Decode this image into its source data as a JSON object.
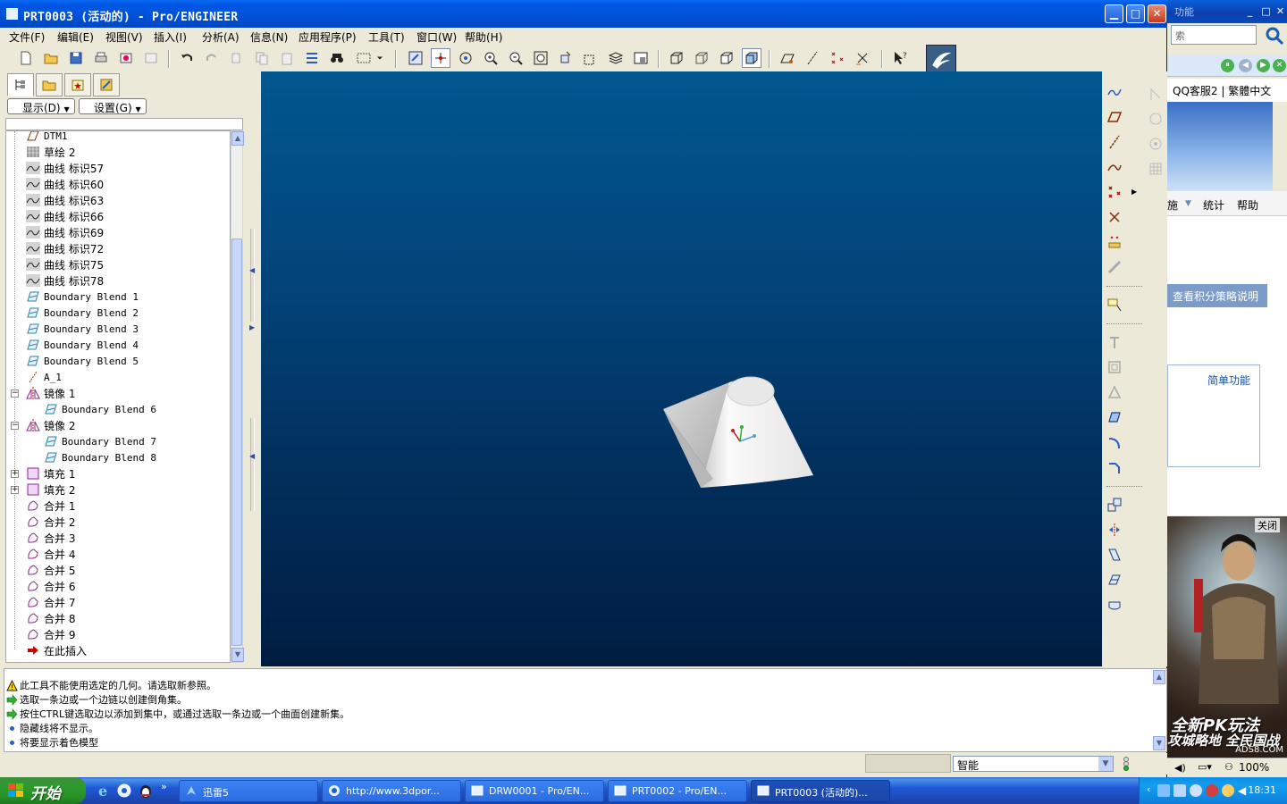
{
  "window": {
    "title": "PRT0003 (活动的) - Pro/ENGINEER",
    "controls": {
      "minimize": "_",
      "maximize": "□",
      "close": "X"
    }
  },
  "menubar": {
    "items": [
      "文件(F)",
      "编辑(E)",
      "视图(V)",
      "插入(I)",
      "分析(A)",
      "信息(N)",
      "应用程序(P)",
      "工具(T)",
      "窗口(W)",
      "帮助(H)"
    ]
  },
  "tree_panel": {
    "show_dropdown": "显示(D)",
    "settings_dropdown": "设置(G)",
    "items": [
      {
        "label": "DTM1",
        "icon": "datum-plane-icon",
        "level": 0,
        "expander": ""
      },
      {
        "label": "草绘 2",
        "icon": "sketch-icon",
        "level": 0,
        "expander": ""
      },
      {
        "label": "曲线 标识57",
        "icon": "curve-icon",
        "level": 0,
        "expander": ""
      },
      {
        "label": "曲线 标识60",
        "icon": "curve-icon",
        "level": 0,
        "expander": ""
      },
      {
        "label": "曲线 标识63",
        "icon": "curve-icon",
        "level": 0,
        "expander": ""
      },
      {
        "label": "曲线 标识66",
        "icon": "curve-icon",
        "level": 0,
        "expander": ""
      },
      {
        "label": "曲线 标识69",
        "icon": "curve-icon",
        "level": 0,
        "expander": ""
      },
      {
        "label": "曲线 标识72",
        "icon": "curve-icon",
        "level": 0,
        "expander": ""
      },
      {
        "label": "曲线 标识75",
        "icon": "curve-icon",
        "level": 0,
        "expander": ""
      },
      {
        "label": "曲线 标识78",
        "icon": "curve-icon",
        "level": 0,
        "expander": ""
      },
      {
        "label": "Boundary Blend 1",
        "icon": "boundary-blend-icon",
        "level": 0,
        "expander": ""
      },
      {
        "label": "Boundary Blend 2",
        "icon": "boundary-blend-icon",
        "level": 0,
        "expander": ""
      },
      {
        "label": "Boundary Blend 3",
        "icon": "boundary-blend-icon",
        "level": 0,
        "expander": ""
      },
      {
        "label": "Boundary Blend 4",
        "icon": "boundary-blend-icon",
        "level": 0,
        "expander": ""
      },
      {
        "label": "Boundary Blend 5",
        "icon": "boundary-blend-icon",
        "level": 0,
        "expander": ""
      },
      {
        "label": "A_1",
        "icon": "datum-axis-icon",
        "level": 0,
        "expander": ""
      },
      {
        "label": "镜像 1",
        "icon": "mirror-icon",
        "level": 0,
        "expander": "-"
      },
      {
        "label": "Boundary Blend 6",
        "icon": "boundary-blend-icon",
        "level": 1,
        "expander": ""
      },
      {
        "label": "镜像 2",
        "icon": "mirror-icon",
        "level": 0,
        "expander": "-"
      },
      {
        "label": "Boundary Blend 7",
        "icon": "boundary-blend-icon",
        "level": 1,
        "expander": ""
      },
      {
        "label": "Boundary Blend 8",
        "icon": "boundary-blend-icon",
        "level": 1,
        "expander": ""
      },
      {
        "label": "填充 1",
        "icon": "fill-icon",
        "level": 0,
        "expander": "+"
      },
      {
        "label": "填充 2",
        "icon": "fill-icon",
        "level": 0,
        "expander": "+"
      },
      {
        "label": "合并 1",
        "icon": "merge-icon",
        "level": 0,
        "expander": ""
      },
      {
        "label": "合并 2",
        "icon": "merge-icon",
        "level": 0,
        "expander": ""
      },
      {
        "label": "合并 3",
        "icon": "merge-icon",
        "level": 0,
        "expander": ""
      },
      {
        "label": "合并 4",
        "icon": "merge-icon",
        "level": 0,
        "expander": ""
      },
      {
        "label": "合并 5",
        "icon": "merge-icon",
        "level": 0,
        "expander": ""
      },
      {
        "label": "合并 6",
        "icon": "merge-icon",
        "level": 0,
        "expander": ""
      },
      {
        "label": "合并 7",
        "icon": "merge-icon",
        "level": 0,
        "expander": ""
      },
      {
        "label": "合并 8",
        "icon": "merge-icon",
        "level": 0,
        "expander": ""
      },
      {
        "label": "合并 9",
        "icon": "merge-icon",
        "level": 0,
        "expander": ""
      },
      {
        "label": "在此插入",
        "icon": "insert-here-arrow-icon",
        "level": 0,
        "expander": ""
      }
    ]
  },
  "messages": [
    {
      "icon": "warning-icon",
      "text": "此工具不能使用选定的几何。请选取新参照。"
    },
    {
      "icon": "prompt-arrow-icon",
      "text": "选取一条边或一个边链以创建倒角集。"
    },
    {
      "icon": "prompt-arrow-icon",
      "text": "按住CTRL键选取边以添加到集中，或通过选取一条边或一个曲面创建新集。"
    },
    {
      "icon": "info-bullet-icon",
      "text": "隐藏线将不显示。"
    },
    {
      "icon": "info-bullet-icon",
      "text": "将要显示着色模型"
    }
  ],
  "status": {
    "filter_value": "智能"
  },
  "background_window": {
    "title": "功能",
    "search_placeholder": "索",
    "lang": "QQ客服2 | 繁體中文",
    "menu_left": "施",
    "menu_stats": "统计",
    "menu_help": "帮助",
    "strategy": "查看积分策略说明",
    "simple": "简单功能",
    "ad_close": "关闭",
    "ad_line1": "全新PK玩法",
    "ad_line2": "攻城略地 全民国战",
    "ad_source": "ADS8.COM",
    "zoom": "100%"
  },
  "taskbar": {
    "start": "开始",
    "tasks": [
      {
        "label": "迅雷5",
        "active": false
      },
      {
        "label": "http://www.3dpor...",
        "active": false
      },
      {
        "label": "DRW0001 - Pro/EN...",
        "active": false
      },
      {
        "label": "PRT0002 - Pro/EN...",
        "active": false
      },
      {
        "label": "PRT0003 (活动的)...",
        "active": true
      }
    ],
    "clock": "18:31"
  },
  "colors": {
    "viewport_top": "#00578f",
    "viewport_bottom": "#001d40",
    "titlebar": "#0058e6",
    "taskbar": "#2157d7"
  }
}
